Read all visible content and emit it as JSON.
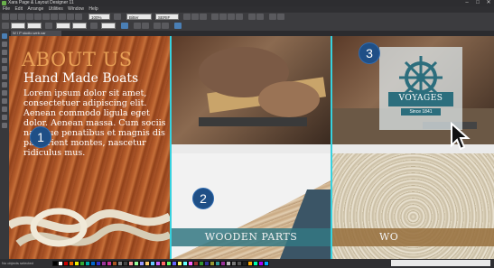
{
  "window": {
    "title": "Xara Page & Layout Designer 11",
    "controls": [
      "–",
      "□",
      "✕"
    ]
  },
  "menu": [
    "File",
    "Edit",
    "Arrange",
    "Utilities",
    "Window",
    "Help"
  ],
  "toolbar": {
    "font_name": "Bitter",
    "font_size": "SERIF",
    "zoom": "100%"
  },
  "document_tab": {
    "label": "W I P studio.web.xar"
  },
  "about_panel": {
    "title": "ABOUT US",
    "subtitle": "Hand Made Boats",
    "body": "Lorem ipsum dolor sit amet, consectetuer adipiscing elit. Aenean commodo ligula eget dolor. Aenean massa. Cum sociis natoque penatibus et magnis dis parturient montes, nascetur ridiculus mus."
  },
  "badges": {
    "one": "1",
    "two": "2",
    "three": "3"
  },
  "captions": {
    "wooden_parts": "WOODEN PARTS",
    "right": "WO"
  },
  "logo": {
    "name": "VOYAGES",
    "since": "Since 1841",
    "color": "#2c6e7d"
  },
  "status": {
    "left_text": "No objects selected"
  },
  "colors": {
    "accent_orange": "#e9a157",
    "guide": "#35d2e0",
    "badge_blue": "#1f4f86"
  }
}
